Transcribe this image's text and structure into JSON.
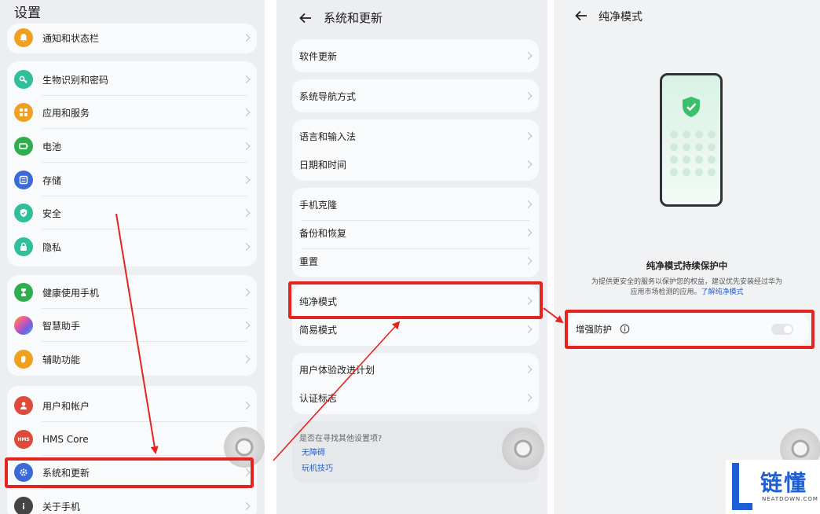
{
  "panel1": {
    "title": "设置",
    "items": [
      {
        "label": "通知和状态栏",
        "icon": "bell-icon",
        "color": "#f0a020"
      },
      {
        "label": "生物识别和密码",
        "icon": "key-icon",
        "color": "#2fbf9a"
      },
      {
        "label": "应用和服务",
        "icon": "apps-icon",
        "color": "#f0a020"
      },
      {
        "label": "电池",
        "icon": "battery-icon",
        "color": "#2fae4f"
      },
      {
        "label": "存储",
        "icon": "storage-icon",
        "color": "#3a69d8"
      },
      {
        "label": "安全",
        "icon": "shield-icon",
        "color": "#2fbf9a"
      },
      {
        "label": "隐私",
        "icon": "lock-icon",
        "color": "#2fbf9a"
      },
      {
        "label": "健康使用手机",
        "icon": "hourglass-icon",
        "color": "#2fae4f"
      },
      {
        "label": "智慧助手",
        "icon": "assistant-icon",
        "color": "#a066e0"
      },
      {
        "label": "辅助功能",
        "icon": "hand-icon",
        "color": "#f0a020"
      },
      {
        "label": "用户和帐户",
        "icon": "user-icon",
        "color": "#e04a3a"
      },
      {
        "label": "HMS Core",
        "icon": "hms-icon",
        "color": "#e04a3a",
        "badge": "HMS"
      },
      {
        "label": "系统和更新",
        "icon": "gear-icon",
        "color": "#3a69d8"
      },
      {
        "label": "关于手机",
        "icon": "info-icon",
        "color": "#444444"
      }
    ]
  },
  "panel2": {
    "title": "系统和更新",
    "items": [
      {
        "label": "软件更新"
      },
      {
        "label": "系统导航方式"
      },
      {
        "label": "语言和输入法"
      },
      {
        "label": "日期和时间"
      },
      {
        "label": "手机克隆"
      },
      {
        "label": "备份和恢复"
      },
      {
        "label": "重置"
      },
      {
        "label": "纯净模式"
      },
      {
        "label": "简易模式"
      },
      {
        "label": "用户体验改进计划"
      },
      {
        "label": "认证标志"
      }
    ],
    "suggest": {
      "question": "是否在寻找其他设置项?",
      "link1": "无障碍",
      "link2": "玩机技巧"
    }
  },
  "panel3": {
    "title": "纯净模式",
    "status_title": "纯净模式持续保护中",
    "desc_line1": "为提供更安全的服务以保护您的权益，建议优先安装经过华为",
    "desc_line2": "应用市场检测的应用。",
    "desc_link": "了解纯净模式",
    "toggle_label": "增强防护",
    "toggle_state": "off"
  },
  "watermark": {
    "brand": "链懂",
    "site": "NEATDOWN.COM",
    "letter": "L"
  },
  "colors": {
    "highlight": "#e4241e",
    "link": "#2a5fc8",
    "accent_green": "#2fae4f"
  }
}
